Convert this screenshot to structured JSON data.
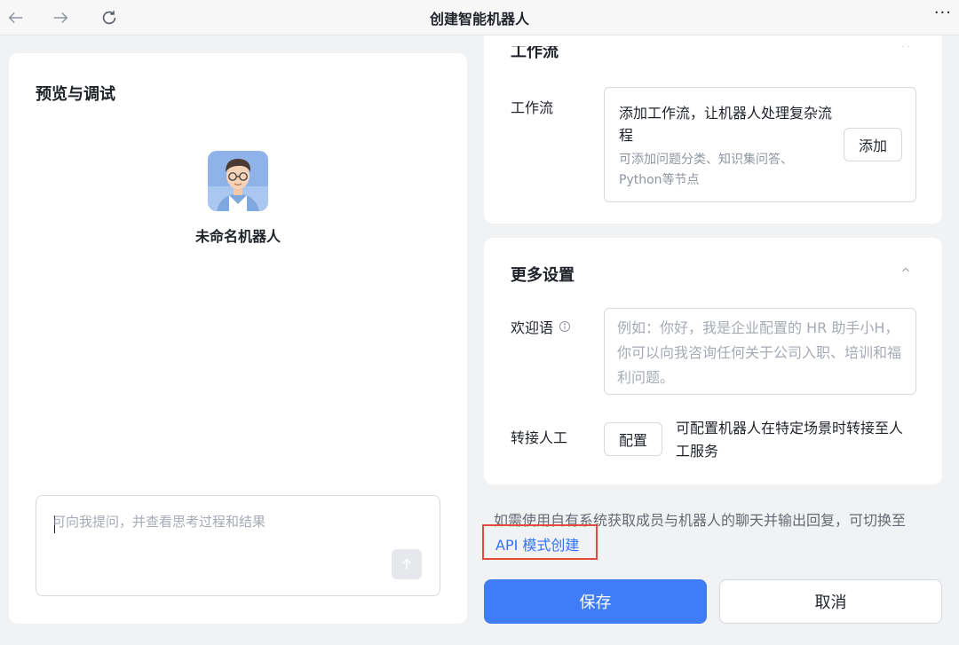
{
  "window": {
    "title": "创建智能机器人",
    "back_icon": "arrow-left-icon",
    "forward_icon": "arrow-right-icon",
    "reload_icon": "reload-icon",
    "more_label": "···"
  },
  "preview": {
    "title": "预览与调试",
    "bot_name": "未命名机器人",
    "input_placeholder": "可向我提问，并查看思考过程和结果",
    "send_icon": "arrow-up-icon"
  },
  "workflow": {
    "section_title": "工作流",
    "label": "工作流",
    "box_title": "添加工作流，让机器人处理复杂流程",
    "box_desc": "可添加问题分类、知识集问答、Python等节点",
    "add_label": "添加"
  },
  "settings": {
    "title": "更多设置",
    "welcome_label": "欢迎语",
    "welcome_placeholder": "例如：你好，我是企业配置的 HR 助手小H，你可以向我咨询任何关于公司入职、培训和福利问题。",
    "transfer_label": "转接人工",
    "config_label": "配置",
    "transfer_desc": "可配置机器人在特定场景时转接至人工服务"
  },
  "api": {
    "hint": "如需使用自有系统获取成员与机器人的聊天并输出回复，可切换至",
    "link": "API 模式创建"
  },
  "actions": {
    "save_label": "保存",
    "cancel_label": "取消"
  },
  "colors": {
    "primary": "#3f7cf5",
    "link": "#3370ff",
    "highlight": "#e14b3b"
  }
}
